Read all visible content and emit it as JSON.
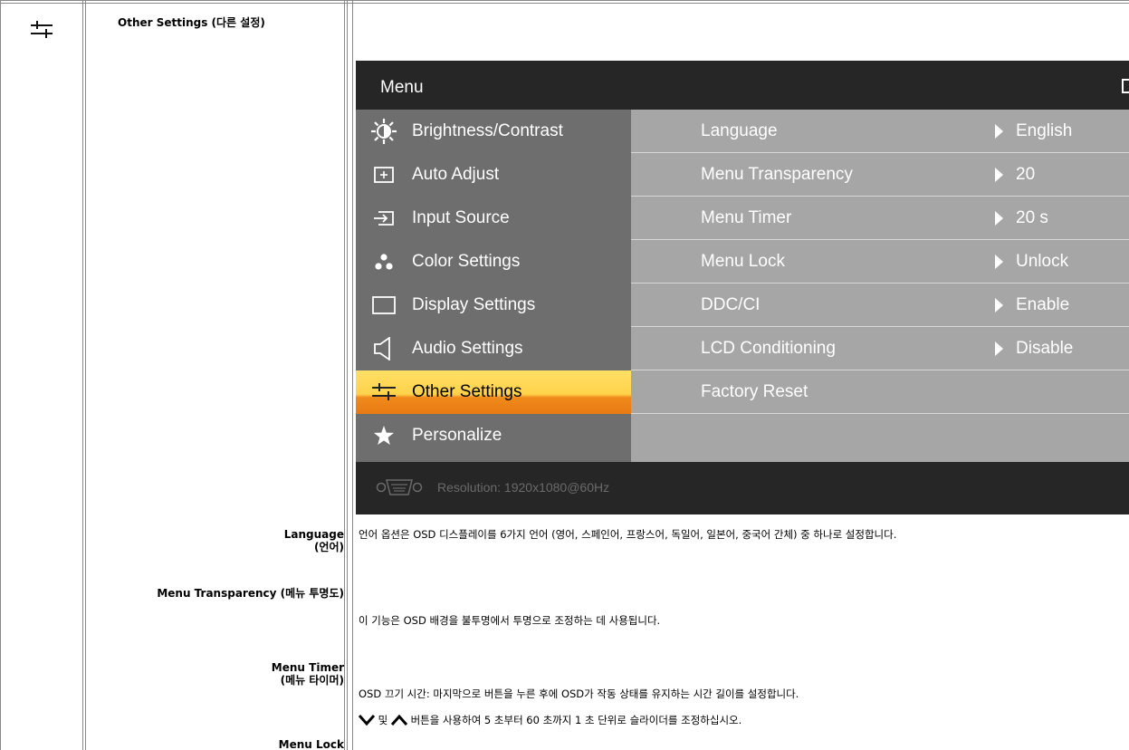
{
  "heading": "Other Settings (다른 설정)",
  "osd": {
    "title": "Menu",
    "menu_items": [
      {
        "label": "Brightness/Contrast",
        "icon": "brightness-icon"
      },
      {
        "label": "Auto Adjust",
        "icon": "auto-adjust-icon"
      },
      {
        "label": "Input Source",
        "icon": "input-source-icon"
      },
      {
        "label": "Color Settings",
        "icon": "color-settings-icon"
      },
      {
        "label": "Display Settings",
        "icon": "display-settings-icon"
      },
      {
        "label": "Audio Settings",
        "icon": "speaker-icon"
      },
      {
        "label": "Other Settings",
        "icon": "sliders-icon",
        "active": true
      },
      {
        "label": "Personalize",
        "icon": "star-icon"
      }
    ],
    "settings": [
      {
        "name": "Language",
        "value": "English"
      },
      {
        "name": "Menu Transparency",
        "value": "20"
      },
      {
        "name": "Menu Timer",
        "value": "20 s"
      },
      {
        "name": "Menu Lock",
        "value": "Unlock"
      },
      {
        "name": "DDC/CI",
        "value": "Enable"
      },
      {
        "name": "LCD Conditioning",
        "value": "Disable"
      },
      {
        "name": "Factory Reset",
        "value": ""
      }
    ],
    "resolution": "Resolution:  1920x1080@60Hz"
  },
  "rows": {
    "language_label": "Language",
    "language_sub": "(언어)",
    "language_desc": "언어 옵션은 OSD 디스플레이를 6가지 언어 (영어, 스페인어, 프랑스어, 독일어, 일본어, 중국어 간체) 중 하나로 설정합니다.",
    "transparency_label": "Menu Transparency (메뉴 투명도)",
    "transparency_desc": "이 기능은 OSD 배경을 불투명에서 투명으로 조정하는 데 사용됩니다.",
    "timer_label": "Menu Timer",
    "timer_sub": "(메뉴 타이머)",
    "timer_desc": "OSD 끄기 시간: 마지막으로 버튼을 누른 후에 OSD가 작동 상태를 유지하는 시간 길이를 설정합니다.",
    "timer_desc2_mid": "및",
    "timer_desc2_rest": "버튼을 사용하여 5 초부터 60 초까지 1 초 단위로 슬라이더를 조정하십시오.",
    "lock_label": "Menu Lock"
  }
}
